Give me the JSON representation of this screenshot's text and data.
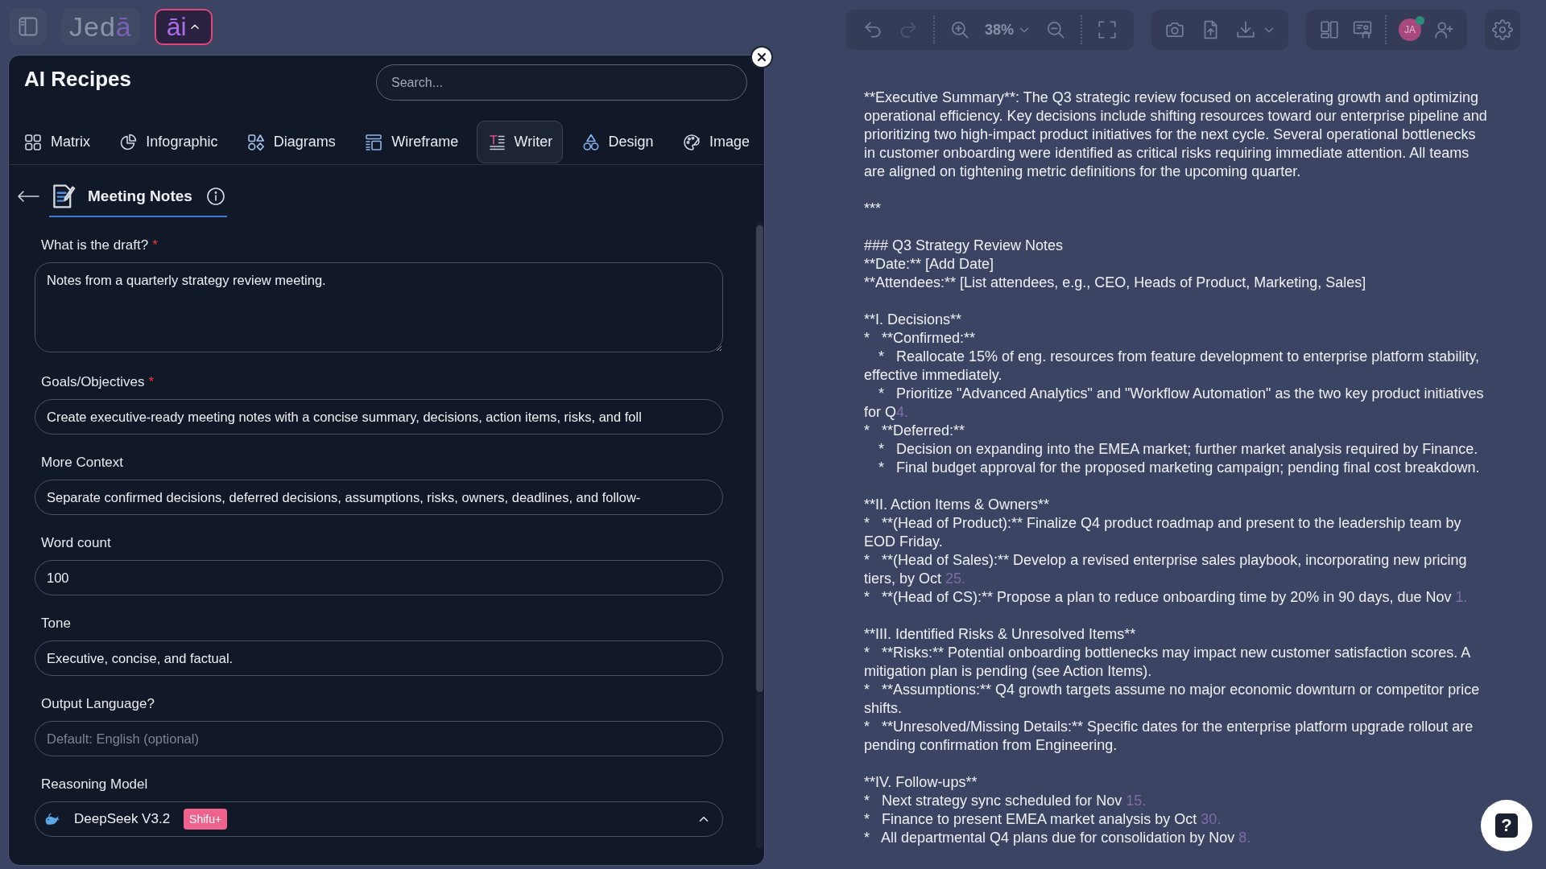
{
  "topbar": {
    "logo": {
      "main": "Jed",
      "accent": "ā"
    },
    "ai_button": {
      "label": "āi",
      "expanded": true
    }
  },
  "toolbar": {
    "undo": {
      "disabled": false
    },
    "redo": {
      "disabled": true
    },
    "zoom": "38%",
    "avatar": {
      "initials": "JA",
      "online": true
    }
  },
  "panel": {
    "title": "AI Recipes",
    "search": {
      "placeholder": "Search..."
    },
    "tabs": [
      {
        "label": "Matrix",
        "selected": false
      },
      {
        "label": "Infographic",
        "selected": false
      },
      {
        "label": "Diagrams",
        "selected": false
      },
      {
        "label": "Wireframe",
        "selected": false
      },
      {
        "label": "Writer",
        "selected": true
      },
      {
        "label": "Design",
        "selected": false
      },
      {
        "label": "Image",
        "selected": false
      }
    ],
    "recipe": {
      "title": "Meeting Notes"
    },
    "fields": [
      {
        "kind": "textarea",
        "label": "What is the draft?",
        "required_mark": "*",
        "value": "Notes from a quarterly strategy review meeting."
      },
      {
        "kind": "input",
        "label": "Goals/Objectives",
        "required_mark": "*",
        "value": "Create executive-ready meeting notes with a concise summary, decisions, action items, risks, and foll"
      },
      {
        "kind": "input",
        "label": "More Context",
        "value": "Separate confirmed decisions, deferred decisions, assumptions, risks, owners, deadlines, and follow-"
      },
      {
        "kind": "input",
        "label": "Word count",
        "value": "100"
      },
      {
        "kind": "input",
        "label": "Tone",
        "value": "Executive, concise, and factual."
      },
      {
        "kind": "input",
        "label": "Output Language?",
        "placeholder": "Default: English (optional)"
      },
      {
        "kind": "select",
        "label": "Reasoning Model",
        "value": "DeepSeek V3.2",
        "badge": "Shifu+",
        "expanded": true
      }
    ]
  },
  "document": {
    "blocks": [
      {
        "lines": [
          {
            "text": "**Executive Summary**: The Q3 strategic review focused on accelerating growth and optimizing operational efficiency. Key decisions include shifting resources toward our enterprise pipeline and prioritizing two high-impact product initiatives for the next cycle. Several operational bottlenecks in customer onboarding were identified as critical risks requiring immediate attention. All teams are aligned on tightening metric definitions for the upcoming quarter."
          }
        ]
      },
      {
        "lines": [
          {
            "text": "***"
          }
        ]
      },
      {
        "lines": [
          {
            "text": "### Q3 Strategy Review Notes"
          },
          {
            "text": "**Date:** [Add Date]"
          },
          {
            "text": "**Attendees:** [List attendees, e.g., CEO, Heads of Product, Marketing, Sales]"
          }
        ]
      },
      {
        "lines": [
          {
            "text": "**I. Decisions**"
          },
          {
            "text": "*   **Confirmed:**",
            "children": [
              {
                "text": "*   Reallocate 15% of eng. resources from feature development to enterprise platform stability, effective immediately."
              },
              {
                "text": "*   Prioritize \"Advanced Analytics\" and \"Workflow Automation\" as the two key product initiatives for Q",
                "faded_tail": "4."
              }
            ]
          },
          {
            "text": "*   **Deferred:**",
            "children": [
              {
                "text": "*   Decision on expanding into the EMEA market; further market analysis required by Finance."
              },
              {
                "text": "*   Final budget approval for the proposed marketing campaign; pending final cost breakdown."
              }
            ]
          }
        ]
      },
      {
        "lines": [
          {
            "text": "**II. Action Items & Owners**"
          },
          {
            "text": "*   **(Head of Product):** Finalize Q4 product roadmap and present to the leadership team by EOD Friday."
          },
          {
            "text": "*   **(Head of Sales):** Develop a revised enterprise sales playbook, incorporating new pricing tiers, by Oct ",
            "faded_tail": "25."
          },
          {
            "text": "*   **(Head of CS):** Propose a plan to reduce onboarding time by 20% in 90 days, due Nov ",
            "faded_tail": "1."
          }
        ]
      },
      {
        "lines": [
          {
            "text": "**III. Identified Risks & Unresolved Items**"
          },
          {
            "text": "*   **Risks:** Potential onboarding bottlenecks may impact new customer satisfaction scores. A mitigation plan is pending (see Action Items)."
          },
          {
            "text": "*   **Assumptions:** Q4 growth targets assume no major economic downturn or competitor price shifts."
          },
          {
            "text": "*   **Unresolved/Missing Details:** Specific dates for the enterprise platform upgrade rollout are pending confirmation from Engineering."
          }
        ]
      },
      {
        "lines": [
          {
            "text": "**IV. Follow-ups**"
          },
          {
            "text": "*   Next strategy sync scheduled for Nov ",
            "faded_tail": "15."
          },
          {
            "text": "*   Finance to present EMEA market analysis by Oct ",
            "faded_tail": "30."
          },
          {
            "text": "*   All departmental Q4 plans due for consolidation by Nov ",
            "faded_tail": "8."
          }
        ]
      }
    ]
  },
  "help_button": {
    "label": "?"
  }
}
